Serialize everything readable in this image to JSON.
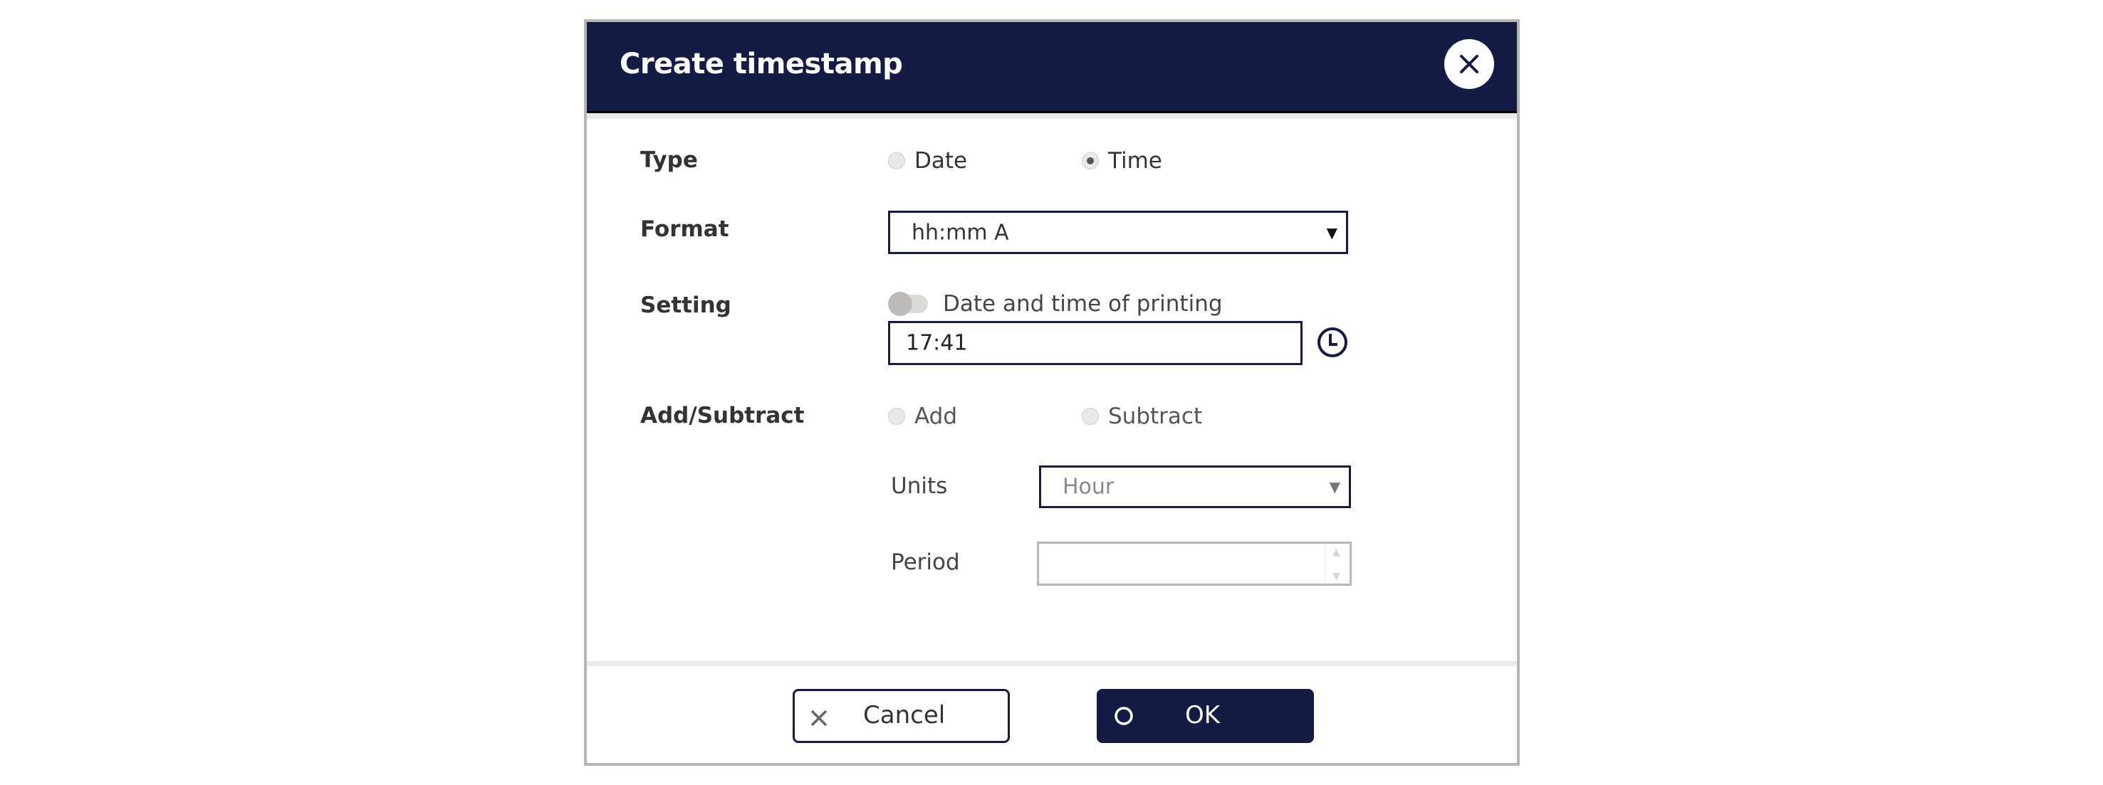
{
  "dialog": {
    "title": "Create timestamp",
    "close_icon": "close-icon"
  },
  "form": {
    "type": {
      "label": "Type",
      "options": [
        {
          "label": "Date",
          "selected": false
        },
        {
          "label": "Time",
          "selected": true
        }
      ]
    },
    "format": {
      "label": "Format",
      "value": "hh:mm A"
    },
    "setting": {
      "label": "Setting",
      "toggle_label": "Date and time of printing",
      "toggle_on": false,
      "time_value": "17:41",
      "clock_icon": "clock-icon"
    },
    "add_subtract": {
      "label": "Add/Subtract",
      "options": [
        {
          "label": "Add",
          "selected": false
        },
        {
          "label": "Subtract",
          "selected": false
        }
      ],
      "units_label": "Units",
      "units_value": "Hour",
      "period_label": "Period",
      "period_value": ""
    }
  },
  "footer": {
    "cancel_label": "Cancel",
    "ok_label": "OK"
  },
  "colors": {
    "primary": "#141b45",
    "border": "#b8b5b2"
  }
}
